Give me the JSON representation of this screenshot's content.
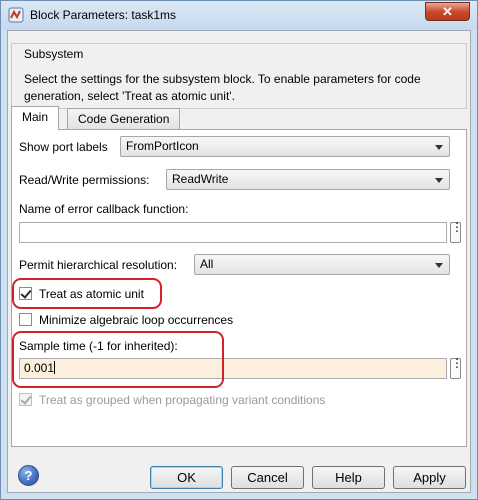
{
  "window": {
    "title": "Block Parameters: task1ms",
    "close_symbol": "✕"
  },
  "group": {
    "legend": "Subsystem",
    "description": "Select the settings for the subsystem block. To enable parameters for code generation, select 'Treat as atomic unit'."
  },
  "tabs": [
    {
      "label": "Main",
      "active": true
    },
    {
      "label": "Code Generation",
      "active": false
    }
  ],
  "main": {
    "show_port_labels": {
      "label": "Show port labels",
      "value": "FromPortIcon"
    },
    "read_write": {
      "label": "Read/Write permissions:",
      "value": "ReadWrite"
    },
    "error_callback": {
      "label": "Name of error callback function:",
      "value": ""
    },
    "hierarchical": {
      "label": "Permit hierarchical resolution:",
      "value": "All"
    },
    "atomic": {
      "label": "Treat as atomic unit",
      "checked": true
    },
    "minimize_loops": {
      "label": "Minimize algebraic loop occurrences",
      "checked": false
    },
    "sample_time": {
      "label": "Sample time (-1 for inherited):",
      "value": "0.001"
    },
    "grouped_variant": {
      "label": "Treat as grouped when propagating variant conditions",
      "checked": true,
      "enabled": false
    },
    "dots_label": "⋮"
  },
  "buttons": {
    "help_icon_glyph": "?",
    "ok": "OK",
    "cancel": "Cancel",
    "help": "Help",
    "apply": "Apply"
  },
  "colors": {
    "highlight": "#d2232a",
    "window_frame": "#cfe0f1",
    "close_button": "#c8452a"
  }
}
